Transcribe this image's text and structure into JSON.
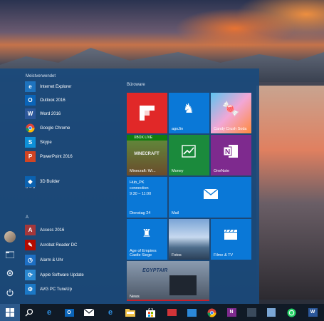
{
  "start_menu": {
    "groups": {
      "most_used": "Meistverwendet",
      "digits": "0 – 9",
      "a": "A"
    },
    "most_used": [
      {
        "label": "Internet Explorer",
        "icon": "internet-explorer-icon",
        "color": "#1e73be"
      },
      {
        "label": "Outlook 2016",
        "icon": "outlook-icon",
        "color": "#0a64b8"
      },
      {
        "label": "Word 2016",
        "icon": "word-icon",
        "color": "#2b579a"
      },
      {
        "label": "Google Chrome",
        "icon": "chrome-icon",
        "color": "#3b7fd6"
      },
      {
        "label": "Skype",
        "icon": "skype-icon",
        "color": "#0d8fd8"
      },
      {
        "label": "PowerPoint 2016",
        "icon": "powerpoint-icon",
        "color": "#d04423"
      }
    ],
    "digits": [
      {
        "label": "3D Builder",
        "icon": "3d-builder-icon",
        "color": "#0b62b0"
      }
    ],
    "a": [
      {
        "label": "Access 2016",
        "icon": "access-icon",
        "color": "#a4373a"
      },
      {
        "label": "Acrobat Reader DC",
        "icon": "acrobat-icon",
        "color": "#b30b00"
      },
      {
        "label": "Alarm & Uhr",
        "icon": "alarm-clock-icon",
        "color": "#1d6fc4"
      },
      {
        "label": "Apple Software Update",
        "icon": "apple-update-icon",
        "color": "#2a88d0"
      },
      {
        "label": "AVG PC TuneUp",
        "icon": "avg-tuneup-icon",
        "color": "#1b78c6"
      }
    ]
  },
  "tiles": {
    "section_title": "Büroware",
    "flipboard": {
      "label": ""
    },
    "age_of_empires_casual": {
      "label": "agoJin"
    },
    "candy_crush": {
      "label": "Candy Crush Soda"
    },
    "minecraft": {
      "label": "Minecraft: Wi...",
      "badge": "XBOX LIVE"
    },
    "money": {
      "label": "Money"
    },
    "onenote": {
      "label": "OneNote"
    },
    "calendar": {
      "line1": "Hub_PK",
      "line2": "connection",
      "line3": "9:30 – 11:00",
      "footer": "Dienstag 24"
    },
    "mail": {
      "label": "Mail"
    },
    "age_of_empires": {
      "label": "Age of Empires Castle Siege"
    },
    "photos": {
      "label": "Fotos"
    },
    "movies": {
      "label": "Filme & TV"
    },
    "news": {
      "label": "News",
      "headline": "EGYPTAIR"
    }
  },
  "colors": {
    "start_bg": "#1a4a7c",
    "tile_blue": "#0a78d7",
    "flipboard_red": "#e12828",
    "money_green": "#1b8a3c",
    "onenote_purple": "#7e2a8e",
    "minecraft_green": "#107c10"
  }
}
